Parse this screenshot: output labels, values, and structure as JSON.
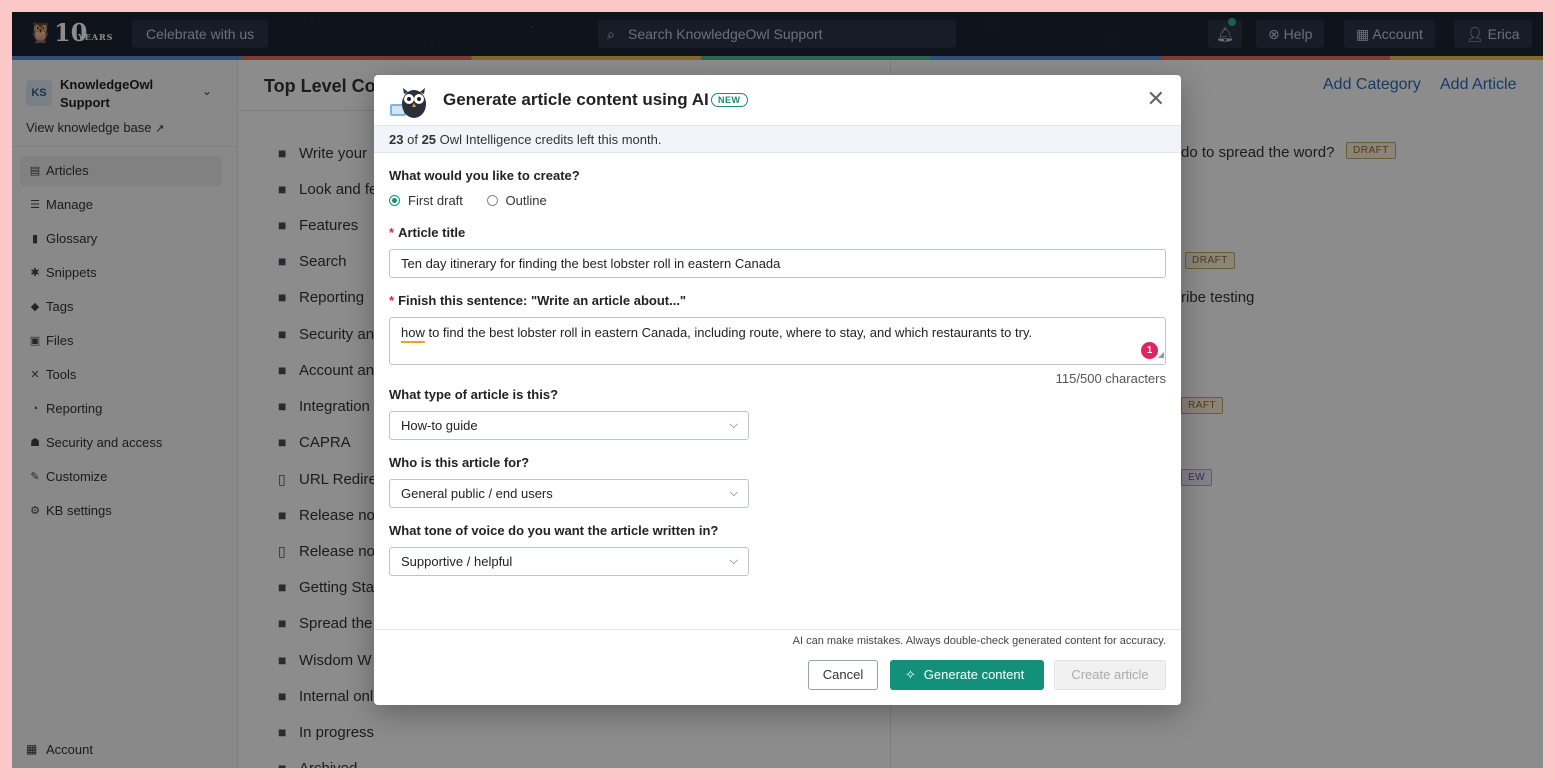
{
  "topbar": {
    "logo_text": "10",
    "logo_sub": "YEARS",
    "celebrate_label": "Celebrate with us",
    "search_placeholder": "Search KnowledgeOwl Support",
    "help_label": "Help",
    "account_label": "Account",
    "user_label": "Erica",
    "icons": {
      "bell": "bell-icon",
      "help": "help-circle-icon",
      "account": "building-icon",
      "user": "user-icon"
    }
  },
  "sidebar": {
    "kb_badge": "KS",
    "kb_name": "KnowledgeOwl Support",
    "view_kb": "View knowledge base",
    "items": [
      {
        "label": "Articles",
        "icon": "▤"
      },
      {
        "label": "Manage",
        "icon": "☰"
      },
      {
        "label": "Glossary",
        "icon": "▮"
      },
      {
        "label": "Snippets",
        "icon": "✱"
      },
      {
        "label": "Tags",
        "icon": "◆"
      },
      {
        "label": "Files",
        "icon": "▣"
      },
      {
        "label": "Tools",
        "icon": "✕"
      },
      {
        "label": "Reporting",
        "icon": "◔"
      },
      {
        "label": "Security and access",
        "icon": "☗"
      },
      {
        "label": "Customize",
        "icon": "✎"
      },
      {
        "label": "KB settings",
        "icon": "⚙"
      }
    ],
    "account_label": "Account"
  },
  "middle": {
    "title": "Top Level Co",
    "categories": [
      {
        "label": "Write your",
        "icon": "folder"
      },
      {
        "label": "Look and fe",
        "icon": "folder"
      },
      {
        "label": "Features",
        "icon": "folder"
      },
      {
        "label": "Search",
        "icon": "folder"
      },
      {
        "label": "Reporting",
        "icon": "folder"
      },
      {
        "label": "Security an",
        "icon": "folder"
      },
      {
        "label": "Account an",
        "icon": "folder"
      },
      {
        "label": "Integration",
        "icon": "folder"
      },
      {
        "label": "CAPRA",
        "icon": "folder"
      },
      {
        "label": "URL Redire",
        "icon": "doc"
      },
      {
        "label": "Release no",
        "icon": "folder"
      },
      {
        "label": "Release no",
        "icon": "doc"
      },
      {
        "label": "Getting Sta",
        "icon": "folder"
      },
      {
        "label": "Spread the",
        "icon": "folder"
      },
      {
        "label": "Wisdom W",
        "icon": "folder"
      },
      {
        "label": "Internal onl",
        "icon": "folder"
      },
      {
        "label": "In progress",
        "icon": "folder"
      },
      {
        "label": "Archived",
        "icon": "folder"
      }
    ]
  },
  "right": {
    "add_category": "Add Category",
    "add_article": "Add Article",
    "row1_text": "do to spread the word?",
    "draft": "DRAFT",
    "row3_text": "ribe testing",
    "draft_partial": "RAFT",
    "new_partial": "EW"
  },
  "modal": {
    "title": "Generate article content using AI",
    "new_badge": "NEW",
    "credits_used": "23",
    "credits_of": "of",
    "credits_total": "25",
    "credits_text": "Owl Intelligence credits left this month.",
    "create_question": "What would you like to create?",
    "options": [
      "First draft",
      "Outline"
    ],
    "selected_option": "First draft",
    "required_mark": "*",
    "title_label": "Article title",
    "title_value": "Ten day itinerary for finding the best lobster roll in eastern Canada",
    "sentence_label": "Finish this sentence: \"Write an article about...\"",
    "sentence_first_word": "how",
    "sentence_rest": " to find the best lobster roll in eastern Canada, including route, where to stay, and which restaurants to try.",
    "error_count": "1",
    "char_count": "115/500 characters",
    "type_label": "What type of article is this?",
    "type_value": "How-to guide",
    "audience_label": "Who is this article for?",
    "audience_value": "General public / end users",
    "tone_label": "What tone of voice do you want the article written in?",
    "tone_value": "Supportive / helpful",
    "disclaimer": "AI can make mistakes. Always double-check generated content for accuracy.",
    "cancel_label": "Cancel",
    "generate_label": "Generate content",
    "create_label": "Create article",
    "accent_color": "#11907a"
  }
}
